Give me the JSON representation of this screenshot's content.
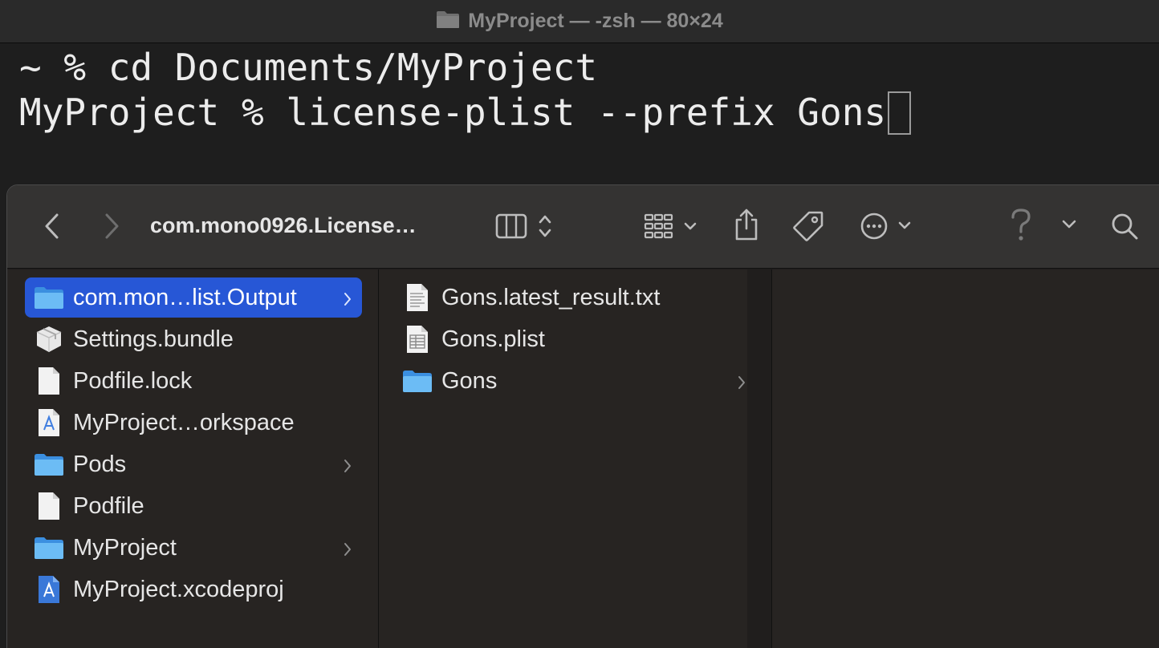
{
  "terminal": {
    "title": "MyProject — -zsh — 80×24",
    "lines": [
      "~ % cd Documents/MyProject",
      "MyProject % license-plist --prefix Gons"
    ]
  },
  "finder": {
    "toolbar": {
      "path_title": "com.mono0926.License…",
      "icons": [
        "back-icon",
        "forward-icon",
        "column-view-icon",
        "grid-view-icon",
        "share-icon",
        "tag-icon",
        "more-icon",
        "help-icon",
        "chevron-down-icon",
        "search-icon"
      ]
    },
    "column1": [
      {
        "label": "com.mon…list.Output",
        "icon": "folder-icon",
        "has_children": true,
        "selected": true
      },
      {
        "label": "Settings.bundle",
        "icon": "bundle-icon",
        "has_children": false
      },
      {
        "label": "Podfile.lock",
        "icon": "document-icon",
        "has_children": false
      },
      {
        "label": "MyProject…orkspace",
        "icon": "xcode-workspace-icon",
        "has_children": false
      },
      {
        "label": "Pods",
        "icon": "folder-icon",
        "has_children": true
      },
      {
        "label": "Podfile",
        "icon": "document-icon",
        "has_children": false
      },
      {
        "label": "MyProject",
        "icon": "folder-icon",
        "has_children": true
      },
      {
        "label": "MyProject.xcodeproj",
        "icon": "xcode-project-icon",
        "has_children": false
      }
    ],
    "column2": [
      {
        "label": "Gons.latest_result.txt",
        "icon": "text-file-icon",
        "has_children": false
      },
      {
        "label": "Gons.plist",
        "icon": "plist-file-icon",
        "has_children": false
      },
      {
        "label": "Gons",
        "icon": "folder-icon",
        "has_children": true
      }
    ],
    "colors": {
      "selection": "#2757d6",
      "folder": "#5fb0f0",
      "toolbar": "#343332",
      "column_bg": "#272422"
    }
  }
}
